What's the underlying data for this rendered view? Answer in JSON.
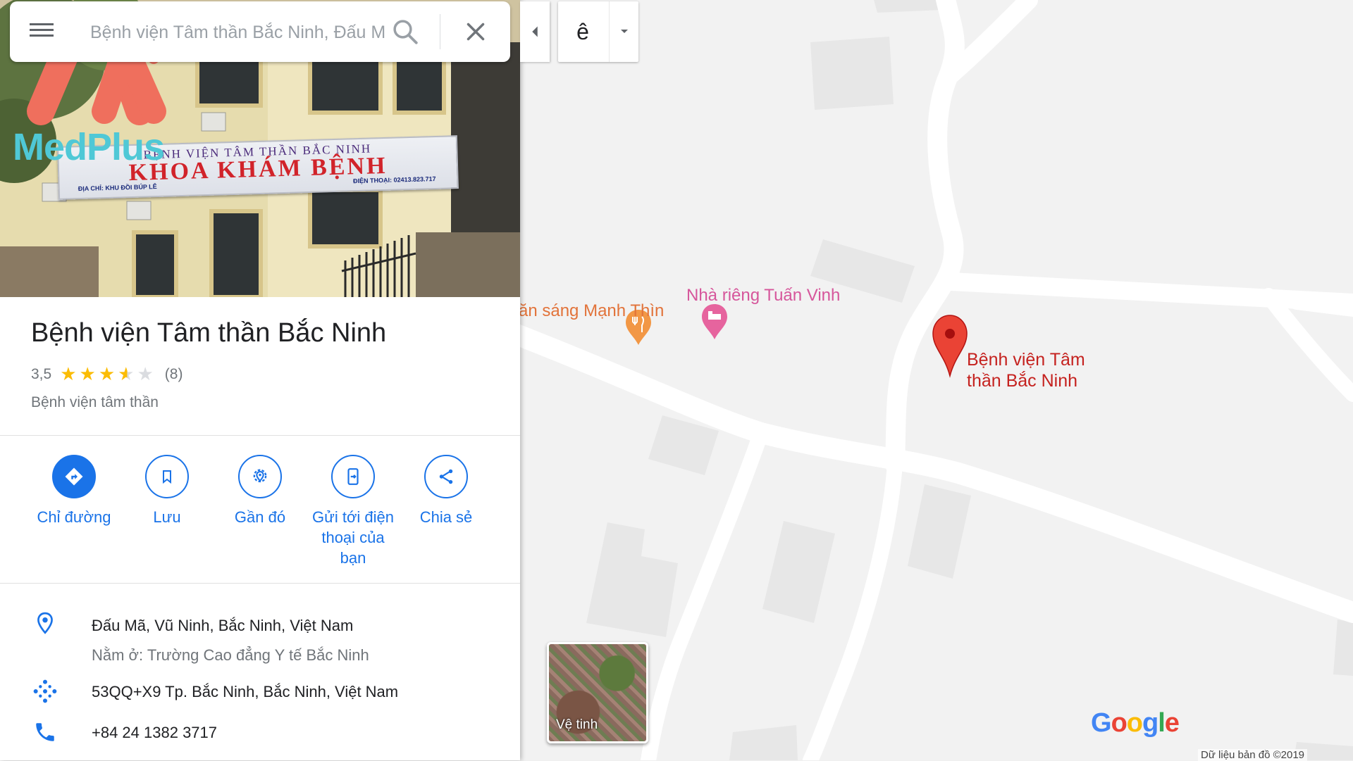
{
  "search": {
    "placeholder": "Bệnh viện Tâm thần Bắc Ninh, Đấu Mã",
    "value": "Bệnh viện Tâm thần Bắc Ninh, Đấu Mã"
  },
  "ime": {
    "char": "ê"
  },
  "watermark": {
    "brand": "MedPlus"
  },
  "hero": {
    "sign_line1": "BỆNH VIỆN TÂM THẦN BẮC NINH",
    "sign_line2": "KHOA KHÁM BỆNH",
    "sign_address": "ĐỊA CHỈ: KHU ĐỒI BÚP LÊ",
    "sign_phone": "ĐIỆN THOẠI: 02413.823.717"
  },
  "place": {
    "title": "Bệnh viện Tâm thần Bắc Ninh",
    "rating": "3,5",
    "rating_value": 3.5,
    "review_count": "(8)",
    "category": "Bệnh viện tâm thần"
  },
  "actions": [
    {
      "label": "Chỉ đường",
      "icon": "directions-icon"
    },
    {
      "label": "Lưu",
      "icon": "bookmark-icon"
    },
    {
      "label": "Gần đó",
      "icon": "nearby-icon"
    },
    {
      "label": "Gửi tới điện thoại của bạn",
      "icon": "send-to-phone-icon"
    },
    {
      "label": "Chia sẻ",
      "icon": "share-icon"
    }
  ],
  "details": {
    "address": "Đấu Mã, Vũ Ninh, Bắc Ninh, Việt Nam",
    "located_in": "Nằm ở: Trường Cao đẳng Y tế Bắc Ninh",
    "plus_code": "53QQ+X9 Tp. Bắc Ninh, Bắc Ninh, Việt Nam",
    "phone": "+84 24 1382 3717"
  },
  "map": {
    "poi_food": "ăn sáng Mạnh Thìn",
    "poi_home": "Nhà riêng Tuấn Vinh",
    "place_marker": "Bệnh viện Tâm thần Bắc Ninh",
    "satellite_label": "Vệ tinh",
    "copyright": "Dữ liệu bản đồ ©2019"
  },
  "colors": {
    "accent": "#1a73e8",
    "star": "#fbbc04",
    "marker": "#ea4335",
    "poi_food": "#e2733a",
    "poi_home": "#d6569b"
  }
}
